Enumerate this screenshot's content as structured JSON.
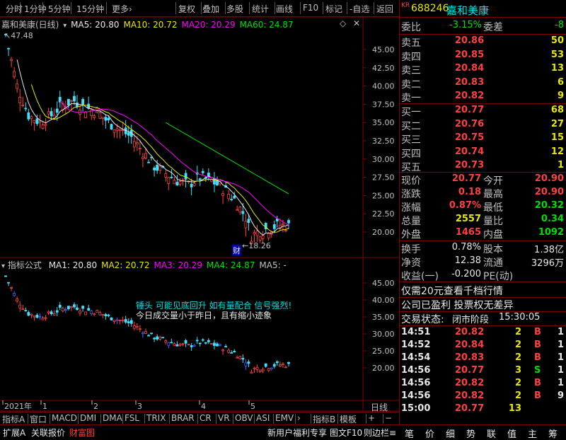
{
  "toolbar": {
    "left_items": [
      "分时",
      "1分钟",
      "5分钟",
      "15分钟",
      "更多›"
    ],
    "right_items": [
      "复权",
      "叠加",
      "多股",
      "统计",
      "画线",
      "F10",
      "标记",
      "-自选",
      "返回"
    ]
  },
  "main_chart": {
    "title": "嘉和美康(日线)",
    "ma_labels": [
      {
        "text": "MA5: 20.80",
        "color": "#e8e8e8"
      },
      {
        "text": "MA10: 20.72",
        "color": "#e8e800"
      },
      {
        "text": "MA20: 20.29",
        "color": "#ff00ff"
      },
      {
        "text": "MA60: 24.87",
        "color": "#00e000"
      }
    ],
    "high_label": "47.48",
    "low_label": "18.26",
    "cai_label": "财",
    "y_ticks": [
      "45.00",
      "42.50",
      "40.00",
      "37.50",
      "35.00",
      "32.50",
      "30.00",
      "27.50",
      "25.00",
      "22.50",
      "20.00"
    ]
  },
  "indicator": {
    "title": "指标公式",
    "ma_labels": [
      {
        "text": "MA1: 20.80",
        "color": "#e8e8e8"
      },
      {
        "text": "MA2: 20.72",
        "color": "#e8e800"
      },
      {
        "text": "MA3: 20.29",
        "color": "#ff00ff"
      },
      {
        "text": "MA4: 24.87",
        "color": "#00e000"
      },
      {
        "text": "MA5: -",
        "color": "#c0c0c0"
      }
    ],
    "msg1": "锤头 可能见底回升 如有量配合 信号强烈!",
    "msg2": "今日成交量小于昨日，且有缩小迹象",
    "y_ticks": [
      "45.00",
      "40.00",
      "35.00",
      "30.00",
      "25.00",
      "20.00"
    ]
  },
  "x_axis": {
    "labels": [
      "2021年",
      "1",
      "2",
      "3",
      "4",
      "5"
    ],
    "period": "日线"
  },
  "tabs": [
    "指标A",
    "窗口",
    "MACD",
    "DMI",
    "DMA",
    "FSL",
    "TRIX",
    "BRAR",
    "CR",
    "VR",
    "OBV",
    "ASI",
    "EMV",
    "›",
    "指标B",
    "模板",
    "+",
    "−"
  ],
  "quote": {
    "kr": "KR",
    "code": "688246",
    "name": "嘉和美康",
    "weibi_label": "委比",
    "weibi": "-3.15%",
    "weicha_label": "委差",
    "weicha": "-8",
    "asks": [
      {
        "label": "卖五",
        "price": "20.86",
        "vol": "50"
      },
      {
        "label": "卖四",
        "price": "20.85",
        "vol": "53"
      },
      {
        "label": "卖三",
        "price": "20.84",
        "vol": "13"
      },
      {
        "label": "卖二",
        "price": "20.83",
        "vol": "6"
      },
      {
        "label": "卖一",
        "price": "20.82",
        "vol": "9"
      }
    ],
    "bids": [
      {
        "label": "买一",
        "price": "20.77",
        "vol": "68"
      },
      {
        "label": "买二",
        "price": "20.76",
        "vol": "27"
      },
      {
        "label": "买三",
        "price": "20.75",
        "vol": "15"
      },
      {
        "label": "买四",
        "price": "20.74",
        "vol": "12"
      },
      {
        "label": "买五",
        "price": "20.73",
        "vol": "1"
      }
    ],
    "stats": [
      {
        "l1": "现价",
        "v1": "20.77",
        "c1": "#ff4040",
        "l2": "今开",
        "v2": "20.90",
        "c2": "#ff4040"
      },
      {
        "l1": "涨跌",
        "v1": "0.18",
        "c1": "#ff4040",
        "l2": "最高",
        "v2": "20.90",
        "c2": "#ff4040"
      },
      {
        "l1": "涨幅",
        "v1": "0.87%",
        "c1": "#ff4040",
        "l2": "最低",
        "v2": "20.32",
        "c2": "#00e000"
      },
      {
        "l1": "总量",
        "v1": "2557",
        "c1": "#e8e800",
        "l2": "量比",
        "v2": "0.34",
        "c2": "#00e000"
      },
      {
        "l1": "外盘",
        "v1": "1465",
        "c1": "#ff4040",
        "l2": "内盘",
        "v2": "1092",
        "c2": "#00e000"
      }
    ],
    "stats2": [
      {
        "l1": "换手",
        "v1": "0.78%",
        "l2": "股本",
        "v2": "1.38亿"
      },
      {
        "l1": "净资",
        "v1": "12.38",
        "l2": "流通",
        "v2": "3296万"
      },
      {
        "l1": "收益(一)",
        "v1": "-0.200",
        "l2": "PE(动)",
        "v2": ""
      }
    ],
    "notice1": "仅需20元查看千档行情",
    "notice2": "公司已盈利 投票权无差异",
    "status_label": "交易状态:",
    "status_value": "闭市阶段",
    "status_time": "15:30:05",
    "ticks": [
      {
        "t": "14:51",
        "p": "20.82",
        "v": "2",
        "s": "B",
        "n": "1"
      },
      {
        "t": "14:52",
        "p": "20.84",
        "v": "2",
        "s": "B",
        "n": "1"
      },
      {
        "t": "14:54",
        "p": "20.83",
        "v": "2",
        "s": "B",
        "n": "1"
      },
      {
        "t": "14:56",
        "p": "20.77",
        "v": "3",
        "s": "S",
        "n": "1"
      },
      {
        "t": "14:56",
        "p": "20.82",
        "v": "2",
        "s": "B",
        "n": "1"
      },
      {
        "t": "14:56",
        "p": "20.82",
        "v": "2",
        "s": "B",
        "n": "9"
      },
      {
        "t": "15:00",
        "p": "20.77",
        "v": "13",
        "s": "",
        "n": ""
      }
    ]
  },
  "bottom": {
    "left": [
      "扩展A",
      "关联报价",
      "财富图"
    ],
    "mid": [
      "新用户福利专享",
      "图文F10",
      "则边栏≡"
    ],
    "right": [
      "笔",
      "价",
      "细",
      "势",
      "联",
      "值",
      "主",
      "筹"
    ]
  }
}
